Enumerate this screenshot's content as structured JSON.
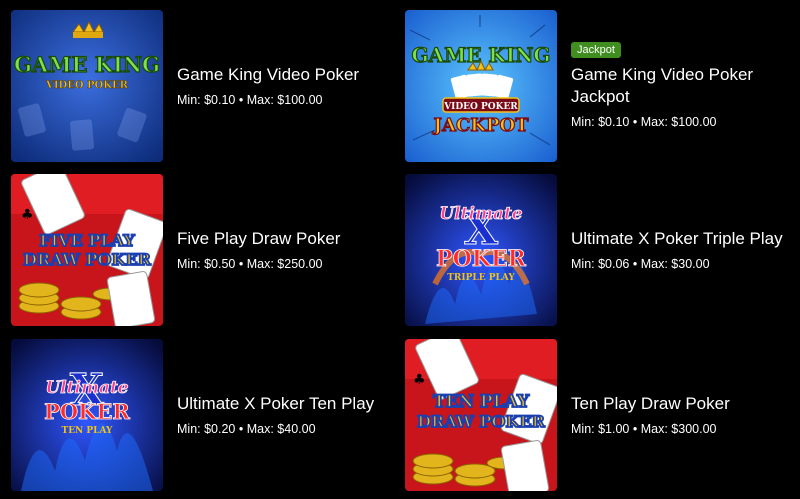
{
  "games": [
    {
      "title": "Game King Video Poker",
      "min": "Min: $0.10",
      "max": "Max: $100.00",
      "separator": "•",
      "art": {
        "line1": "GAME KING",
        "line2": "VIDEO POKER"
      }
    },
    {
      "badge": "Jackpot",
      "title": "Game King Video Poker Jackpot",
      "min": "Min: $0.10",
      "max": "Max: $100.00",
      "separator": "•",
      "art": {
        "line1": "GAME KING",
        "line2": "VIDEO POKER",
        "line3": "JACKPOT"
      }
    },
    {
      "title": "Five Play Draw Poker",
      "min": "Min: $0.50",
      "max": "Max: $250.00",
      "separator": "•",
      "art": {
        "line1": "FIVE PLAY",
        "line2": "DRAW POKER"
      }
    },
    {
      "title": "Ultimate X Poker Triple Play",
      "min": "Min: $0.06",
      "max": "Max: $30.00",
      "separator": "•",
      "art": {
        "line1": "Ultimate",
        "line2": "POKER",
        "line3": "TRIPLE PLAY"
      }
    },
    {
      "title": "Ultimate X Poker Ten Play",
      "min": "Min: $0.20",
      "max": "Max: $40.00",
      "separator": "•",
      "art": {
        "line1": "Ultimate",
        "line2": "POKER",
        "line3": "TEN PLAY"
      }
    },
    {
      "title": "Ten Play Draw Poker",
      "min": "Min: $1.00",
      "max": "Max: $300.00",
      "separator": "•",
      "art": {
        "line1": "TEN PLAY",
        "line2": "DRAW POKER"
      }
    }
  ],
  "colors": {
    "background": "#000000",
    "jackpot_badge": "#3f8e1f",
    "gameking_blue": "#1e4fb8",
    "draw_red": "#c8141b",
    "ultimate_blue": "#0b1fa8",
    "gold": "#f2c21a"
  }
}
